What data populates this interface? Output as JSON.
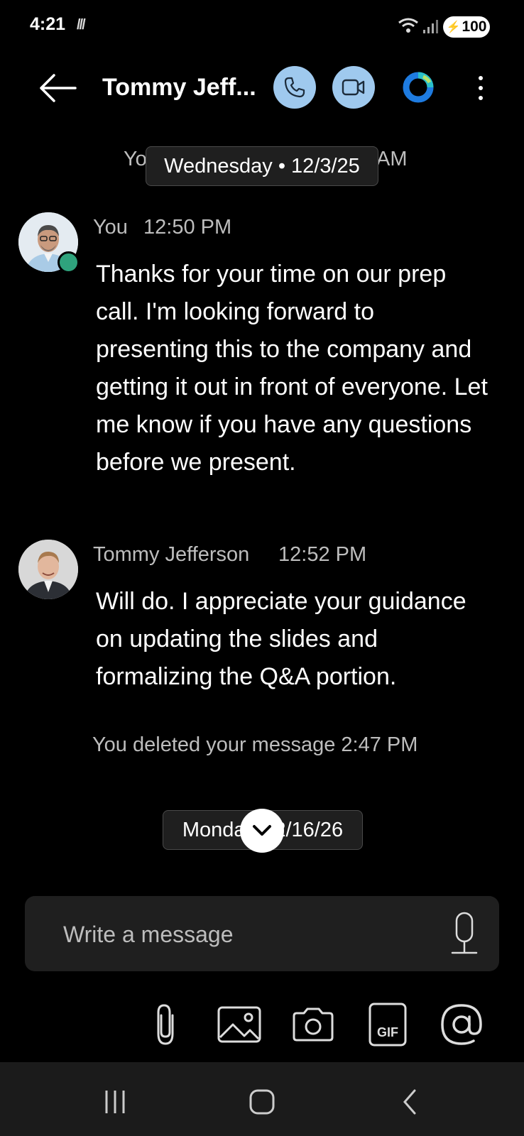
{
  "status_bar": {
    "time": "4:21",
    "extra": "///",
    "battery": "100"
  },
  "header": {
    "title": "Tommy Jeff..."
  },
  "conversation": {
    "top_date_pill": "Wednesday • 12/3/25",
    "hidden_prefix": "Yo",
    "hidden_suffix": "AM",
    "messages": [
      {
        "sender": "You",
        "time": "12:50 PM",
        "body": "Thanks for your time on our prep call. I'm looking forward to presenting this to the company and getting it out in front of everyone. Let me know if you have any questions before we present."
      },
      {
        "sender": "Tommy Jefferson",
        "time": "12:52 PM",
        "body": "Will do. I appreciate your guidance on updating the slides and formalizing the Q&A portion."
      }
    ],
    "deleted_note": "You deleted your message 2:47 PM",
    "bottom_date_pill": "Monday • 2/16/26"
  },
  "composer": {
    "placeholder": "Write a message"
  },
  "colors": {
    "accent_button": "#9fc9ee",
    "presence": "#2fa37d",
    "background": "#000000"
  }
}
